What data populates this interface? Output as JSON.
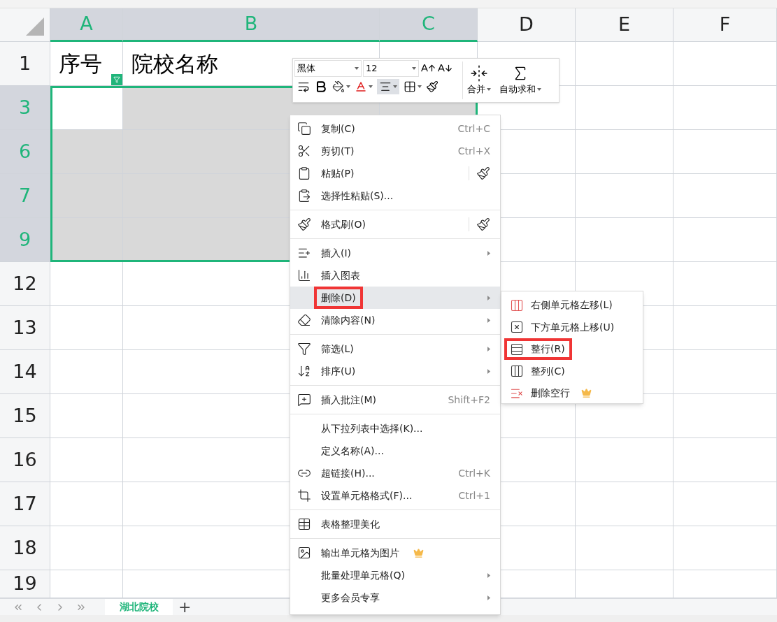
{
  "columns": [
    {
      "label": "A",
      "selected": true,
      "active": true
    },
    {
      "label": "B",
      "selected": true
    },
    {
      "label": "C",
      "selected": true
    },
    {
      "label": "D",
      "selected": false
    },
    {
      "label": "E",
      "selected": false
    },
    {
      "label": "F",
      "selected": false
    }
  ],
  "rows": [
    {
      "label": "1",
      "selected": false,
      "cells": [
        "序号",
        "院校名称"
      ],
      "filter": true
    },
    {
      "label": "3",
      "selected": true,
      "active": true
    },
    {
      "label": "6",
      "selected": true
    },
    {
      "label": "7",
      "selected": true
    },
    {
      "label": "9",
      "selected": true
    },
    {
      "label": "12",
      "selected": false
    },
    {
      "label": "13",
      "selected": false
    },
    {
      "label": "14",
      "selected": false
    },
    {
      "label": "15",
      "selected": false
    },
    {
      "label": "16",
      "selected": false
    },
    {
      "label": "17",
      "selected": false
    },
    {
      "label": "18",
      "selected": false
    },
    {
      "label": "19",
      "selected": false
    }
  ],
  "mini_toolbar": {
    "font": "黑体",
    "size": "12",
    "merge": "合并",
    "autosum": "自动求和",
    "align_active": true
  },
  "context_menu": {
    "groups": [
      [
        {
          "label": "复制(C)",
          "shortcut": "Ctrl+C",
          "submenu": false,
          "highlighted": false,
          "boxed": false,
          "crown": false,
          "side_button": false
        },
        {
          "label": "剪切(T)",
          "shortcut": "Ctrl+X",
          "submenu": false,
          "highlighted": false,
          "boxed": false,
          "crown": false,
          "side_button": false
        },
        {
          "label": "粘贴(P)",
          "submenu": false,
          "highlighted": false,
          "boxed": false,
          "crown": false,
          "side_button": true
        },
        {
          "label": "选择性粘贴(S)...",
          "submenu": false,
          "highlighted": false,
          "boxed": false,
          "crown": false,
          "side_button": false
        }
      ],
      [
        {
          "label": "格式刷(O)",
          "submenu": false,
          "highlighted": false,
          "boxed": false,
          "crown": false,
          "side_button": true
        }
      ],
      [
        {
          "label": "插入(I)",
          "submenu": true,
          "highlighted": false,
          "boxed": false,
          "crown": false,
          "side_button": false
        },
        {
          "label": "插入图表",
          "submenu": false,
          "highlighted": false,
          "boxed": false,
          "crown": false,
          "side_button": false
        },
        {
          "label": "删除(D)",
          "submenu": true,
          "highlighted": true,
          "boxed": true,
          "crown": false,
          "side_button": false
        },
        {
          "label": "清除内容(N)",
          "submenu": true,
          "highlighted": false,
          "boxed": false,
          "crown": false,
          "side_button": false
        }
      ],
      [
        {
          "label": "筛选(L)",
          "submenu": true,
          "highlighted": false,
          "boxed": false,
          "crown": false,
          "side_button": false
        },
        {
          "label": "排序(U)",
          "submenu": true,
          "highlighted": false,
          "boxed": false,
          "crown": false,
          "side_button": false
        }
      ],
      [
        {
          "label": "插入批注(M)",
          "shortcut": "Shift+F2",
          "submenu": false,
          "highlighted": false,
          "boxed": false,
          "crown": false,
          "side_button": false
        }
      ],
      [
        {
          "label": "从下拉列表中选择(K)...",
          "submenu": false,
          "highlighted": false,
          "boxed": false,
          "crown": false,
          "side_button": false
        },
        {
          "label": "定义名称(A)...",
          "submenu": false,
          "highlighted": false,
          "boxed": false,
          "crown": false,
          "side_button": false
        },
        {
          "label": "超链接(H)...",
          "shortcut": "Ctrl+K",
          "submenu": false,
          "highlighted": false,
          "boxed": false,
          "crown": false,
          "side_button": false
        },
        {
          "label": "设置单元格格式(F)...",
          "shortcut": "Ctrl+1",
          "submenu": false,
          "highlighted": false,
          "boxed": false,
          "crown": false,
          "side_button": false
        }
      ],
      [
        {
          "label": "表格整理美化",
          "submenu": false,
          "highlighted": false,
          "boxed": false,
          "crown": false,
          "side_button": false
        }
      ],
      [
        {
          "label": "输出单元格为图片",
          "submenu": false,
          "highlighted": false,
          "boxed": false,
          "crown": true,
          "side_button": false
        },
        {
          "label": "批量处理单元格(Q)",
          "submenu": true,
          "highlighted": false,
          "boxed": false,
          "crown": false,
          "side_button": false
        },
        {
          "label": "更多会员专享",
          "submenu": true,
          "highlighted": false,
          "boxed": false,
          "crown": false,
          "side_button": false
        }
      ]
    ]
  },
  "submenu": [
    {
      "label": "右侧单元格左移(L)",
      "boxed": false,
      "crown": false
    },
    {
      "label": "下方单元格上移(U)",
      "boxed": false,
      "crown": false
    },
    {
      "label": "整行(R)",
      "boxed": true,
      "crown": false
    },
    {
      "label": "整列(C)",
      "boxed": false,
      "crown": false
    },
    {
      "label": "删除空行",
      "boxed": false,
      "crown": true
    }
  ],
  "sheet_tabs": [
    {
      "label": "湖北院校",
      "selected": true
    }
  ],
  "add_sheet": "+"
}
